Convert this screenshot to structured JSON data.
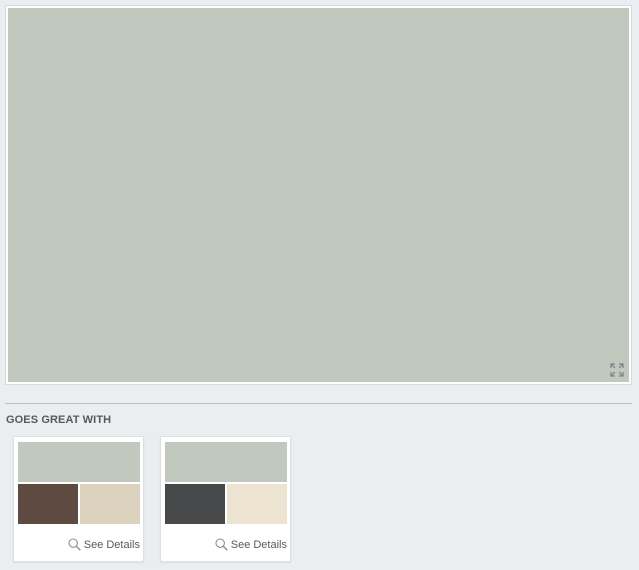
{
  "hero": {
    "color": "#c1c9be",
    "expand_icon": "expand-icon"
  },
  "goes_great_with": {
    "title": "GOES GREAT WITH",
    "cards": [
      {
        "top_color": "#c1c9be",
        "bottom_left_color": "#5e4a40",
        "bottom_right_color": "#dbd3bd",
        "link_label": "See Details",
        "link_icon": "search-icon"
      },
      {
        "top_color": "#c1c9be",
        "bottom_left_color": "#48494b",
        "bottom_right_color": "#ece4d0",
        "link_label": "See Details",
        "link_icon": "search-icon"
      }
    ]
  }
}
